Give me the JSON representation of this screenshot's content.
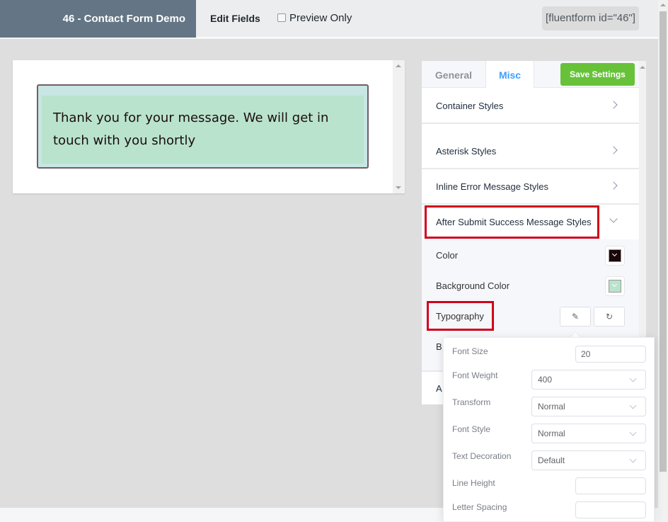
{
  "header": {
    "form_title": "46 - Contact Form Demo",
    "edit_fields": "Edit Fields",
    "preview_only": "Preview Only",
    "preview_checked": false,
    "shortcode": "[fluentform id=\"46\"]"
  },
  "preview": {
    "success_message": "Thank you for your message. We will get in touch with you shortly",
    "text_color": "#1a0c0f",
    "background_color": "#b9e3cd"
  },
  "settings": {
    "tabs": [
      {
        "label": "General",
        "active": false
      },
      {
        "label": "Misc",
        "active": true
      }
    ],
    "save_label": "Save Settings",
    "sections": [
      {
        "label": "Container Styles",
        "expanded": false
      },
      {
        "label": "Asterisk Styles",
        "expanded": false
      },
      {
        "label": "Inline Error Message Styles",
        "expanded": false
      },
      {
        "label": "After Submit Success Message Styles",
        "expanded": true
      }
    ],
    "success_styles": {
      "color_label": "Color",
      "color_value": "#1a0508",
      "bg_label": "Background Color",
      "bg_value": "#b9e3cd",
      "typography_label": "Typography",
      "border_label_partial": "B",
      "next_section_partial": "A"
    }
  },
  "typography": {
    "font_size": {
      "label": "Font Size",
      "value": "20"
    },
    "font_weight": {
      "label": "Font Weight",
      "value": "400"
    },
    "transform": {
      "label": "Transform",
      "value": "Normal"
    },
    "font_style": {
      "label": "Font Style",
      "value": "Normal"
    },
    "text_decoration": {
      "label": "Text Decoration",
      "value": "Default"
    },
    "line_height": {
      "label": "Line Height",
      "value": ""
    },
    "letter_spacing": {
      "label": "Letter Spacing",
      "value": ""
    }
  },
  "icons": {
    "edit": "✎",
    "reset": "↻"
  }
}
